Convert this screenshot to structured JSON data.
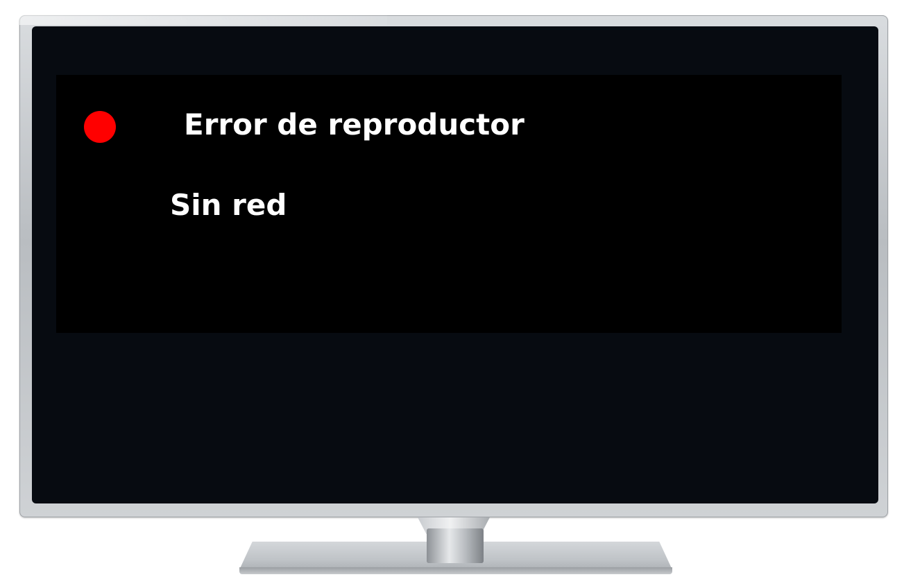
{
  "error": {
    "title": "Error de reproductor",
    "message": "Sin red",
    "status_icon": "status-dot-icon",
    "status_color": "#ff0000"
  }
}
